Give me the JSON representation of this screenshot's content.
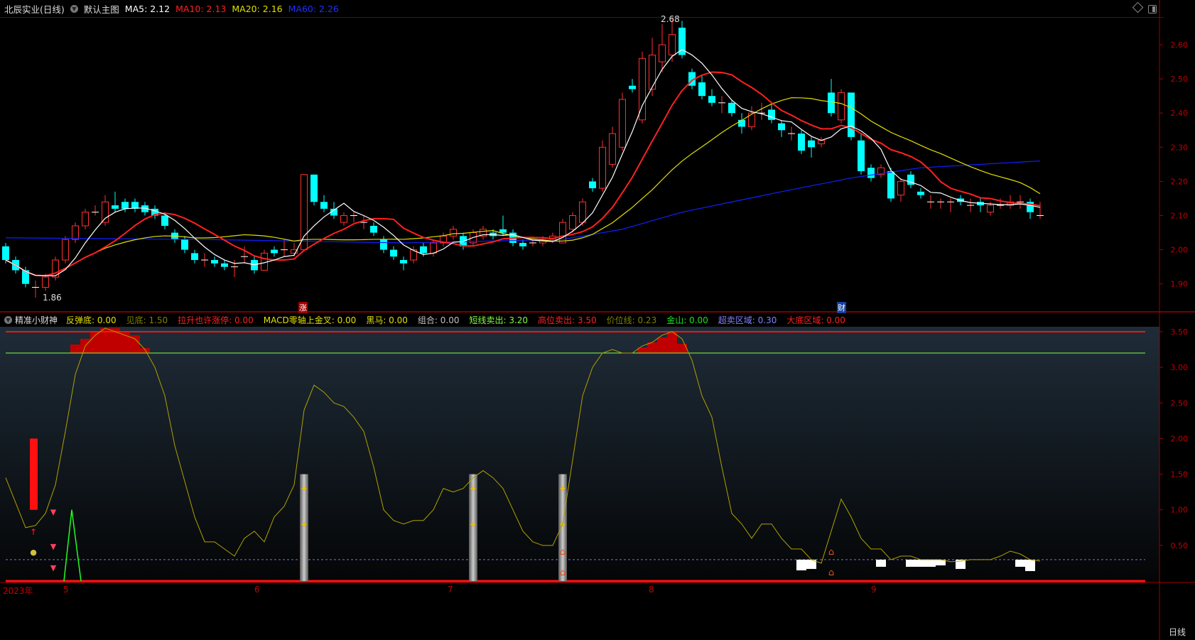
{
  "header": {
    "stock_title": "北辰实业(日线)",
    "template_label": "默认主图",
    "ma5": "MA5: 2.12",
    "ma10": "MA10: 2.13",
    "ma20": "MA20: 2.16",
    "ma60": "MA60: 2.26"
  },
  "indicator_header": {
    "name": "精准小财神",
    "items": [
      {
        "text": "反弹底: 0.00",
        "color": "#e0e000"
      },
      {
        "text": "见底: 1.50",
        "color": "#808000"
      },
      {
        "text": "拉升也许涨停: 0.00",
        "color": "#ff2020"
      },
      {
        "text": "MACD零轴上金叉: 0.00",
        "color": "#e0e000"
      },
      {
        "text": "黑马: 0.00",
        "color": "#e0e000"
      },
      {
        "text": "组合: 0.00",
        "color": "#c0c0c0"
      },
      {
        "text": "短线卖出: 3.20",
        "color": "#80ff40"
      },
      {
        "text": "高位卖出: 3.50",
        "color": "#ff2020"
      },
      {
        "text": "价位线: 0.23",
        "color": "#808000"
      },
      {
        "text": "金山: 0.00",
        "color": "#20e020"
      },
      {
        "text": "超卖区域: 0.30",
        "color": "#8080ff"
      },
      {
        "text": "大底区域: 0.00",
        "color": "#ff2020"
      }
    ]
  },
  "annotations": {
    "high_label": "2.68",
    "low_label": "1.86",
    "signal_rise": "涨",
    "signal_wealth": "财"
  },
  "x_axis": {
    "labels": [
      "2023年",
      "5",
      "6",
      "7",
      "8",
      "9"
    ],
    "timeframe": "日线"
  },
  "colors": {
    "up": "#ff3030",
    "down": "#00ffff",
    "ma5": "#ffffff",
    "ma10": "#ff2020",
    "ma20": "#e0e000",
    "ma60": "#1020ff",
    "axis": "#c00000"
  },
  "chart_data": [
    {
      "type": "candlestick",
      "title": "北辰实业(日线)",
      "y_ticks": [
        "1.90",
        "2.00",
        "2.10",
        "2.20",
        "2.30",
        "2.40",
        "2.50",
        "2.60"
      ],
      "ylim": [
        1.83,
        2.72
      ],
      "candles": [
        [
          2.01,
          2.02,
          1.96,
          1.97
        ],
        [
          1.97,
          1.98,
          1.93,
          1.94
        ],
        [
          1.94,
          1.95,
          1.89,
          1.9
        ],
        [
          1.89,
          1.91,
          1.86,
          1.89
        ],
        [
          1.89,
          1.93,
          1.88,
          1.92
        ],
        [
          1.92,
          1.98,
          1.91,
          1.97
        ],
        [
          1.97,
          2.04,
          1.96,
          2.03
        ],
        [
          2.03,
          2.08,
          2.02,
          2.07
        ],
        [
          2.07,
          2.12,
          2.06,
          2.11
        ],
        [
          2.11,
          2.13,
          2.1,
          2.11
        ],
        [
          2.08,
          2.16,
          2.07,
          2.14
        ],
        [
          2.13,
          2.17,
          2.11,
          2.12
        ],
        [
          2.14,
          2.15,
          2.11,
          2.12
        ],
        [
          2.14,
          2.15,
          2.11,
          2.12
        ],
        [
          2.13,
          2.14,
          2.1,
          2.11
        ],
        [
          2.12,
          2.13,
          2.09,
          2.1
        ],
        [
          2.1,
          2.11,
          2.06,
          2.07
        ],
        [
          2.05,
          2.06,
          2.02,
          2.03
        ],
        [
          2.03,
          2.04,
          1.99,
          2.0
        ],
        [
          1.99,
          2.0,
          1.96,
          1.97
        ],
        [
          1.97,
          1.99,
          1.95,
          1.97
        ],
        [
          1.97,
          1.98,
          1.95,
          1.96
        ],
        [
          1.96,
          1.97,
          1.94,
          1.95
        ],
        [
          1.95,
          1.97,
          1.92,
          1.95
        ],
        [
          1.98,
          2.01,
          1.96,
          1.98
        ],
        [
          1.97,
          1.98,
          1.93,
          1.94
        ],
        [
          1.94,
          2.0,
          1.94,
          1.99
        ],
        [
          2.0,
          2.01,
          1.98,
          1.99
        ],
        [
          2.0,
          2.03,
          1.98,
          2.0
        ],
        [
          1.99,
          2.02,
          1.98,
          2.0
        ],
        [
          2.0,
          2.22,
          2.0,
          2.22
        ],
        [
          2.22,
          2.22,
          2.13,
          2.14
        ],
        [
          2.14,
          2.16,
          2.11,
          2.12
        ],
        [
          2.12,
          2.14,
          2.09,
          2.1
        ],
        [
          2.08,
          2.11,
          2.07,
          2.1
        ],
        [
          2.1,
          2.11,
          2.08,
          2.1
        ],
        [
          2.08,
          2.1,
          2.06,
          2.08
        ],
        [
          2.07,
          2.08,
          2.04,
          2.05
        ],
        [
          2.03,
          2.04,
          1.99,
          2.0
        ],
        [
          2.0,
          2.01,
          1.97,
          1.98
        ],
        [
          1.97,
          1.98,
          1.94,
          1.96
        ],
        [
          1.97,
          2.01,
          1.96,
          2.0
        ],
        [
          2.01,
          2.02,
          1.98,
          1.99
        ],
        [
          1.99,
          2.03,
          1.98,
          2.02
        ],
        [
          2.02,
          2.05,
          2.01,
          2.04
        ],
        [
          2.04,
          2.07,
          2.03,
          2.06
        ],
        [
          2.04,
          2.05,
          2.0,
          2.01
        ],
        [
          2.02,
          2.06,
          2.01,
          2.05
        ],
        [
          2.04,
          2.07,
          2.03,
          2.06
        ],
        [
          2.05,
          2.06,
          2.03,
          2.04
        ],
        [
          2.06,
          2.1,
          2.04,
          2.05
        ],
        [
          2.05,
          2.06,
          2.01,
          2.02
        ],
        [
          2.02,
          2.03,
          2.0,
          2.01
        ],
        [
          2.02,
          2.03,
          2.01,
          2.02
        ],
        [
          2.02,
          2.04,
          2.01,
          2.03
        ],
        [
          2.03,
          2.05,
          2.02,
          2.04
        ],
        [
          2.02,
          2.09,
          2.02,
          2.08
        ],
        [
          2.06,
          2.11,
          2.05,
          2.1
        ],
        [
          2.08,
          2.15,
          2.07,
          2.14
        ],
        [
          2.2,
          2.21,
          2.17,
          2.18
        ],
        [
          2.18,
          2.32,
          2.17,
          2.3
        ],
        [
          2.25,
          2.36,
          2.24,
          2.34
        ],
        [
          2.3,
          2.46,
          2.29,
          2.44
        ],
        [
          2.48,
          2.5,
          2.46,
          2.47
        ],
        [
          2.38,
          2.58,
          2.37,
          2.56
        ],
        [
          2.47,
          2.62,
          2.45,
          2.57
        ],
        [
          2.55,
          2.66,
          2.52,
          2.6
        ],
        [
          2.57,
          2.68,
          2.55,
          2.63
        ],
        [
          2.65,
          2.67,
          2.56,
          2.57
        ],
        [
          2.52,
          2.53,
          2.47,
          2.48
        ],
        [
          2.49,
          2.51,
          2.44,
          2.45
        ],
        [
          2.45,
          2.47,
          2.42,
          2.43
        ],
        [
          2.43,
          2.45,
          2.4,
          2.43
        ],
        [
          2.43,
          2.44,
          2.39,
          2.4
        ],
        [
          2.38,
          2.4,
          2.34,
          2.36
        ],
        [
          2.36,
          2.42,
          2.35,
          2.4
        ],
        [
          2.4,
          2.43,
          2.38,
          2.4
        ],
        [
          2.41,
          2.43,
          2.37,
          2.38
        ],
        [
          2.37,
          2.38,
          2.33,
          2.35
        ],
        [
          2.34,
          2.36,
          2.32,
          2.34
        ],
        [
          2.34,
          2.35,
          2.28,
          2.29
        ],
        [
          2.32,
          2.33,
          2.27,
          2.3
        ],
        [
          2.31,
          2.33,
          2.3,
          2.32
        ],
        [
          2.46,
          2.5,
          2.39,
          2.4
        ],
        [
          2.38,
          2.47,
          2.37,
          2.46
        ],
        [
          2.46,
          2.46,
          2.32,
          2.33
        ],
        [
          2.32,
          2.34,
          2.22,
          2.23
        ],
        [
          2.24,
          2.25,
          2.2,
          2.21
        ],
        [
          2.22,
          2.25,
          2.21,
          2.24
        ],
        [
          2.23,
          2.24,
          2.14,
          2.15
        ],
        [
          2.16,
          2.21,
          2.14,
          2.2
        ],
        [
          2.22,
          2.23,
          2.18,
          2.19
        ],
        [
          2.17,
          2.18,
          2.15,
          2.16
        ],
        [
          2.14,
          2.16,
          2.12,
          2.14
        ],
        [
          2.14,
          2.15,
          2.12,
          2.14
        ],
        [
          2.14,
          2.15,
          2.11,
          2.14
        ],
        [
          2.15,
          2.16,
          2.13,
          2.14
        ],
        [
          2.13,
          2.15,
          2.11,
          2.13
        ],
        [
          2.14,
          2.15,
          2.11,
          2.13
        ],
        [
          2.11,
          2.14,
          2.1,
          2.13
        ],
        [
          2.13,
          2.15,
          2.12,
          2.13
        ],
        [
          2.13,
          2.16,
          2.12,
          2.14
        ],
        [
          2.14,
          2.16,
          2.12,
          2.14
        ],
        [
          2.14,
          2.15,
          2.09,
          2.11
        ],
        [
          2.1,
          2.14,
          2.09,
          2.1
        ]
      ],
      "ma60_points": [
        [
          0,
          2.035
        ],
        [
          20,
          2.03
        ],
        [
          40,
          2.02
        ],
        [
          56,
          2.03
        ],
        [
          62,
          2.06
        ],
        [
          68,
          2.11
        ],
        [
          78,
          2.17
        ],
        [
          85,
          2.21
        ],
        [
          92,
          2.24
        ],
        [
          104,
          2.26
        ]
      ]
    },
    {
      "type": "line",
      "title": "精准小财神",
      "y_ticks": [
        "0.50",
        "1.00",
        "1.50",
        "2.00",
        "2.50",
        "3.00",
        "3.50"
      ],
      "ylim": [
        0,
        3.6
      ],
      "line_values": [
        1.45,
        1.1,
        0.75,
        0.78,
        0.95,
        1.35,
        2.1,
        2.9,
        3.3,
        3.45,
        3.55,
        3.5,
        3.45,
        3.4,
        3.25,
        3.0,
        2.6,
        1.9,
        1.4,
        0.9,
        0.55,
        0.55,
        0.45,
        0.35,
        0.6,
        0.7,
        0.55,
        0.9,
        1.05,
        1.35,
        2.4,
        2.75,
        2.65,
        2.5,
        2.45,
        2.3,
        2.1,
        1.6,
        1.0,
        0.85,
        0.8,
        0.85,
        0.85,
        1.0,
        1.3,
        1.25,
        1.3,
        1.45,
        1.55,
        1.45,
        1.3,
        1.0,
        0.7,
        0.55,
        0.5,
        0.5,
        0.8,
        1.7,
        2.6,
        3.0,
        3.2,
        3.25,
        3.2,
        3.2,
        3.3,
        3.35,
        3.45,
        3.5,
        3.4,
        3.1,
        2.6,
        2.3,
        1.6,
        0.95,
        0.8,
        0.6,
        0.8,
        0.8,
        0.6,
        0.45,
        0.45,
        0.3,
        0.25,
        0.7,
        1.15,
        0.9,
        0.6,
        0.45,
        0.45,
        0.3,
        0.35,
        0.35,
        0.3,
        0.3,
        0.3,
        0.27,
        0.28,
        0.3,
        0.3,
        0.3,
        0.35,
        0.42,
        0.38,
        0.3,
        0.28
      ],
      "short_sell_line": 3.2,
      "high_sell_line": 3.5,
      "oversold_line": 0.3,
      "high_sell_blocks": [
        [
          7,
          3.2,
          3.32
        ],
        [
          8,
          3.2,
          3.4
        ],
        [
          9,
          3.2,
          3.5
        ],
        [
          10,
          3.2,
          3.55
        ],
        [
          11,
          3.2,
          3.55
        ],
        [
          12,
          3.2,
          3.5
        ],
        [
          13,
          3.2,
          3.45
        ],
        [
          14,
          3.2,
          3.27
        ],
        [
          64,
          3.2,
          3.28
        ],
        [
          65,
          3.2,
          3.35
        ],
        [
          66,
          3.2,
          3.42
        ],
        [
          67,
          3.2,
          3.5
        ],
        [
          68,
          3.2,
          3.33
        ]
      ],
      "oversold_blocks": [
        [
          80,
          0.15,
          0.3
        ],
        [
          81,
          0.17,
          0.3
        ],
        [
          88,
          0.2,
          0.3
        ],
        [
          91,
          0.2,
          0.3
        ],
        [
          92,
          0.2,
          0.3
        ],
        [
          93,
          0.2,
          0.3
        ],
        [
          94,
          0.22,
          0.3
        ],
        [
          96,
          0.17,
          0.3
        ],
        [
          102,
          0.2,
          0.3
        ],
        [
          103,
          0.14,
          0.3
        ]
      ],
      "pillars": [
        30,
        47,
        56
      ],
      "rebound_bar": {
        "bar": 3,
        "from": 1.0,
        "to": 2.0
      }
    }
  ]
}
